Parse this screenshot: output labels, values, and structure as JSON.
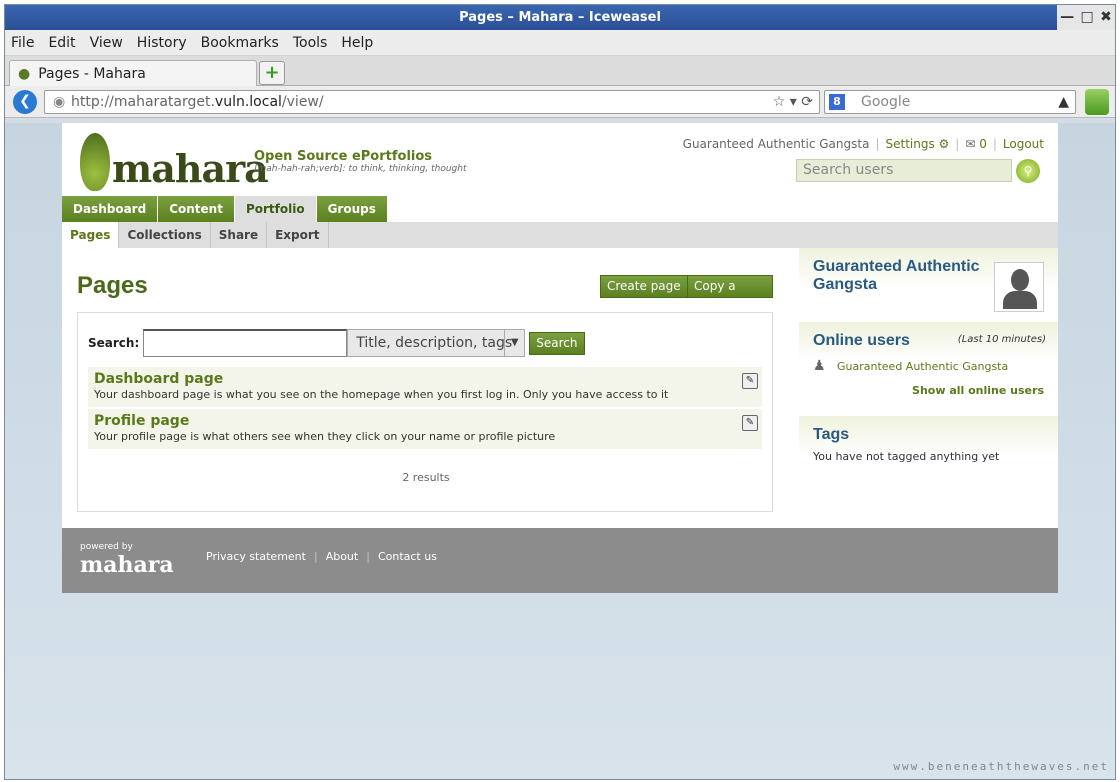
{
  "window": {
    "title": "Pages – Mahara – Iceweasel",
    "controls": [
      "—",
      "□",
      "✖"
    ]
  },
  "menubar": [
    "File",
    "Edit",
    "View",
    "History",
    "Bookmarks",
    "Tools",
    "Help"
  ],
  "tabs": [
    {
      "label": "Pages - Mahara"
    }
  ],
  "newtab_label": "+",
  "nav": {
    "url_prefix": "http://maharatarget.",
    "url_host": "vuln.local",
    "url_path": "/view/",
    "search_engine": "Google",
    "search_placeholder": "Google"
  },
  "site": {
    "logo_text": "mahara",
    "tagline": "Open Source ePortfolios",
    "tagline_sub": "[mah-hah-rah;verb]: to think, thinking, thought",
    "user_name": "Guaranteed Authentic Gangsta",
    "settings_label": "Settings",
    "inbox_count": "0",
    "logout_label": "Logout",
    "user_search_placeholder": "Search users"
  },
  "main_tabs": [
    {
      "label": "Dashboard",
      "active": false
    },
    {
      "label": "Content",
      "active": false
    },
    {
      "label": "Portfolio",
      "active": true
    },
    {
      "label": "Groups",
      "active": false
    }
  ],
  "sub_tabs": [
    {
      "label": "Pages",
      "active": true
    },
    {
      "label": "Collections",
      "active": false
    },
    {
      "label": "Share",
      "active": false
    },
    {
      "label": "Export",
      "active": false
    }
  ],
  "content": {
    "title": "Pages",
    "create_button": "Create page",
    "copy_button": "Copy a page",
    "search_label": "Search:",
    "search_value": "",
    "search_scope": "Title, description, tags",
    "search_button": "Search",
    "items": [
      {
        "title": "Dashboard page",
        "description": "Your dashboard page is what you see on the homepage when you first log in. Only you have access to it"
      },
      {
        "title": "Profile page",
        "description": "Your profile page is what others see when they click on your name or profile picture"
      }
    ],
    "results": "2 results"
  },
  "sidebar": {
    "profile_name": "Guaranteed Authentic Gangsta",
    "online_title": "Online users",
    "online_meta": "(Last 10 minutes)",
    "online_users": [
      "Guaranteed Authentic Gangsta"
    ],
    "show_all": "Show all online users",
    "tags_title": "Tags",
    "tags_note": "You have not tagged anything yet"
  },
  "footer": {
    "powered_by": "powered by",
    "brand": "mahara",
    "links": [
      "Privacy statement",
      "About",
      "Contact us"
    ]
  },
  "watermark": "www.beneneaththewaves.net"
}
